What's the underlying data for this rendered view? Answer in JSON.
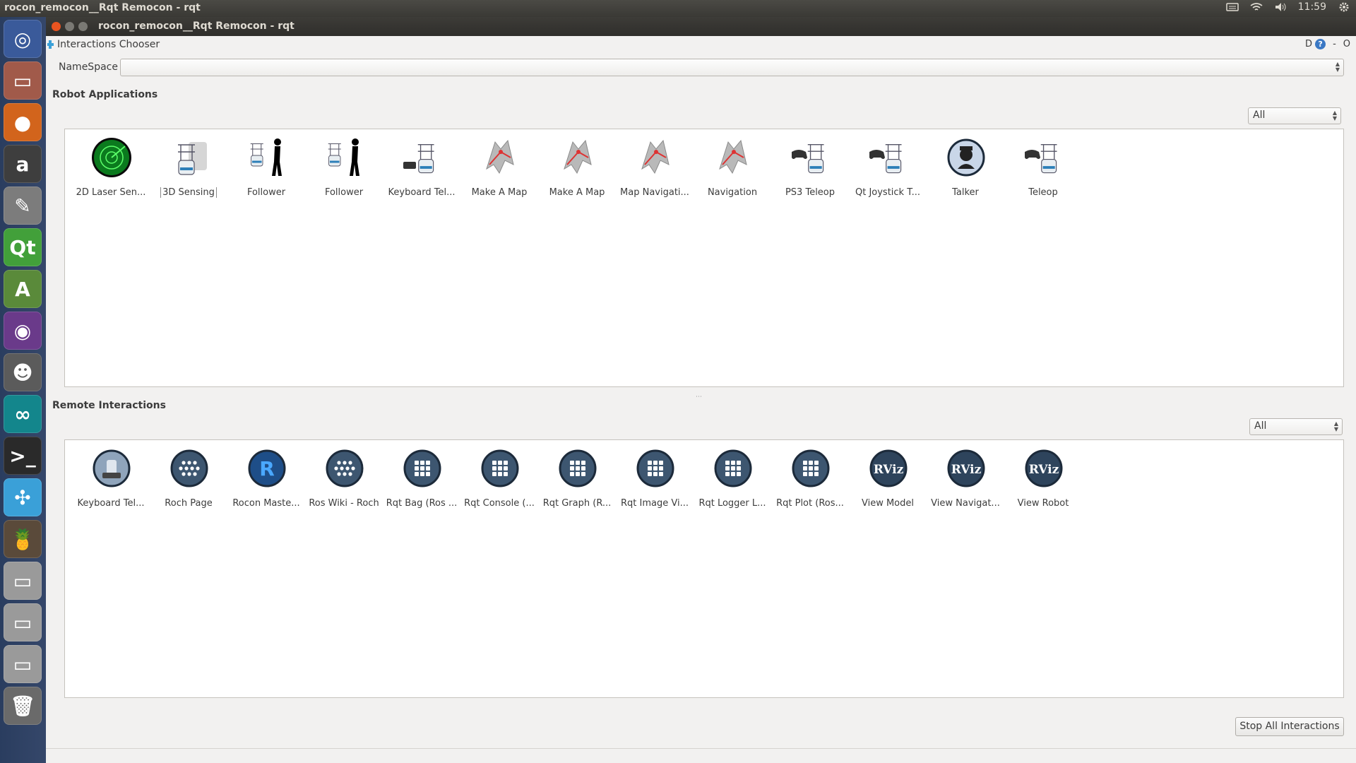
{
  "system_panel": {
    "title": "rocon_remocon__Rqt Remocon - rqt",
    "clock": "11:59"
  },
  "launcher": {
    "items": [
      {
        "name": "ubuntu-dash-icon",
        "glyph": "◎",
        "bg": "#3a5a9a"
      },
      {
        "name": "files-icon",
        "glyph": "▭",
        "bg": "#a15a4a"
      },
      {
        "name": "firefox-icon",
        "glyph": "●",
        "bg": "#d2641c"
      },
      {
        "name": "amazon-icon",
        "glyph": "a",
        "bg": "#3e3e3e"
      },
      {
        "name": "settings-icon",
        "glyph": "✎",
        "bg": "#7c7c7c"
      },
      {
        "name": "qt-creator-icon",
        "glyph": "Qt",
        "bg": "#42a03a"
      },
      {
        "name": "android-studio-icon",
        "glyph": "A",
        "bg": "#5a8a3a"
      },
      {
        "name": "screencast-icon",
        "glyph": "◉",
        "bg": "#6a3a8a"
      },
      {
        "name": "gimp-icon",
        "glyph": "☻",
        "bg": "#5b5b5b"
      },
      {
        "name": "arduino-icon",
        "glyph": "∞",
        "bg": "#13868c"
      },
      {
        "name": "terminal-icon",
        "glyph": ">_",
        "bg": "#2a2a2a"
      },
      {
        "name": "rqt-icon",
        "glyph": "✣",
        "bg": "#3aa0d8"
      },
      {
        "name": "drinks-icon",
        "glyph": "🍍",
        "bg": "#5a4a3a"
      },
      {
        "name": "drive-icon-1",
        "glyph": "▭",
        "bg": "#9a9a9a"
      },
      {
        "name": "drive-icon-2",
        "glyph": "▭",
        "bg": "#9a9a9a"
      },
      {
        "name": "drive-icon-3",
        "glyph": "▭",
        "bg": "#9a9a9a"
      },
      {
        "name": "trash-icon",
        "glyph": "🗑",
        "bg": "#6a6a6a"
      }
    ]
  },
  "window": {
    "title": "rocon_remocon__Rqt Remocon - rqt"
  },
  "plugin": {
    "title": "Interactions Chooser",
    "right_d": "D",
    "right_help": "?",
    "right_dash": "-",
    "right_o": "O"
  },
  "namespace": {
    "label": "NameSpace",
    "value": ""
  },
  "robot_applications": {
    "title": "Robot Applications",
    "filter": "All",
    "items": [
      {
        "label": "2D Laser Sen...",
        "icon": "radar-icon"
      },
      {
        "label": "3D Sensing",
        "icon": "robot-icon",
        "selected": true
      },
      {
        "label": "Follower",
        "icon": "follower-icon"
      },
      {
        "label": "Follower",
        "icon": "follower-icon"
      },
      {
        "label": "Keyboard Tel...",
        "icon": "keyboard-robot-icon"
      },
      {
        "label": "Make A Map",
        "icon": "map-icon"
      },
      {
        "label": "Make A Map",
        "icon": "map-icon"
      },
      {
        "label": "Map Navigati...",
        "icon": "map-icon"
      },
      {
        "label": "Navigation",
        "icon": "map-icon"
      },
      {
        "label": "PS3 Teleop",
        "icon": "gamepad-robot-icon"
      },
      {
        "label": "Qt Joystick T...",
        "icon": "gamepad-robot-icon"
      },
      {
        "label": "Talker",
        "icon": "talker-icon"
      },
      {
        "label": "Teleop",
        "icon": "gamepad-robot-icon"
      }
    ]
  },
  "remote_interactions": {
    "title": "Remote Interactions",
    "filter": "All",
    "items": [
      {
        "label": "Keyboard Tel...",
        "icon": "keyboard-remote-icon"
      },
      {
        "label": "Roch Page",
        "icon": "dots-circle-icon"
      },
      {
        "label": "Rocon Maste...",
        "icon": "rocon-icon"
      },
      {
        "label": "Ros Wiki - Roch",
        "icon": "dots-circle-icon"
      },
      {
        "label": "Rqt Bag (Ros ...",
        "icon": "dots-grid-icon"
      },
      {
        "label": "Rqt Console (...",
        "icon": "dots-grid-icon"
      },
      {
        "label": "Rqt Graph (R...",
        "icon": "dots-grid-icon"
      },
      {
        "label": "Rqt Image Vi...",
        "icon": "dots-grid-icon"
      },
      {
        "label": "Rqt Logger L...",
        "icon": "dots-grid-icon"
      },
      {
        "label": "Rqt Plot (Ros...",
        "icon": "dots-grid-icon"
      },
      {
        "label": "View Model",
        "icon": "rviz-icon"
      },
      {
        "label": "View Navigat...",
        "icon": "rviz-icon"
      },
      {
        "label": "View Robot",
        "icon": "rviz-icon"
      }
    ]
  },
  "stop_button": "Stop All Interactions"
}
